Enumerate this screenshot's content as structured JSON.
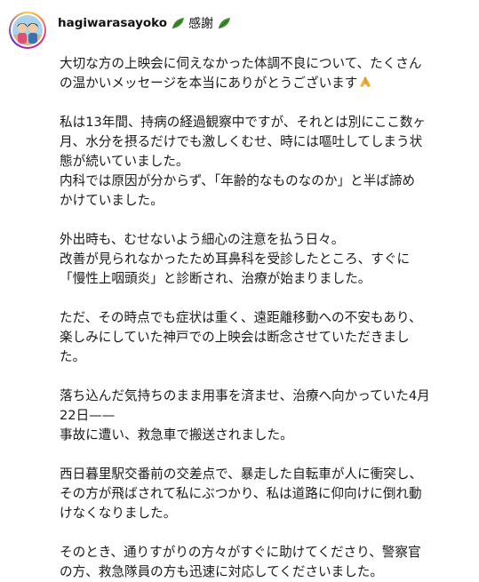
{
  "post": {
    "username": "hagiwarasayoko",
    "header_text": "感謝",
    "header_icons": [
      "leaf-icon",
      "leaf-icon"
    ],
    "caption_paragraphs": [
      {
        "lines": [
          "大切な方の上映会に伺えなかった体調不良について、たくさん",
          "の温かいメッセージを本当にありがとうございます"
        ],
        "trailing_icon": "folded-hands-icon"
      },
      {
        "lines": [
          "私は13年間、持病の経過観察中ですが、それとは別にここ数ヶ",
          "月、水分を摂るだけでも激しくむせ、時には嘔吐してしまう状",
          "態が続いていました。",
          "内科では原因が分からず、「年齢的なものなのか」と半ば諦め",
          "かけていました。"
        ]
      },
      {
        "lines": [
          "外出時も、むせないよう細心の注意を払う日々。",
          "改善が見られなかったため耳鼻科を受診したところ、すぐに",
          "「慢性上咽頭炎」と診断され、治療が始まりました。"
        ]
      },
      {
        "lines": [
          "ただ、その時点でも症状は重く、遠距離移動への不安もあり、",
          "楽しみにしていた神戸での上映会は断念させていただきまし",
          "た。"
        ]
      },
      {
        "lines": [
          "落ち込んだ気持ちのまま用事を済ませ、治療へ向かっていた4月",
          "22日——",
          "事故に遭い、救急車で搬送されました。"
        ]
      },
      {
        "lines": [
          "西日暮里駅交番前の交差点で、暴走した自転車が人に衝突し、",
          "その方が飛ばされて私にぶつかり、私は道路に仰向けに倒れ動",
          "けなくなりました。"
        ]
      },
      {
        "lines": [
          "そのとき、通りすがりの方々がすぐに助けてくださり、警察官",
          "の方、救急隊員の方も迅速に対応してくださいました。"
        ]
      }
    ]
  },
  "colors": {
    "text": "#1a1a1a",
    "background": "#ffffff",
    "leaf_green": "#3e8e2f",
    "avatar_ring": "#ee2a7b"
  }
}
